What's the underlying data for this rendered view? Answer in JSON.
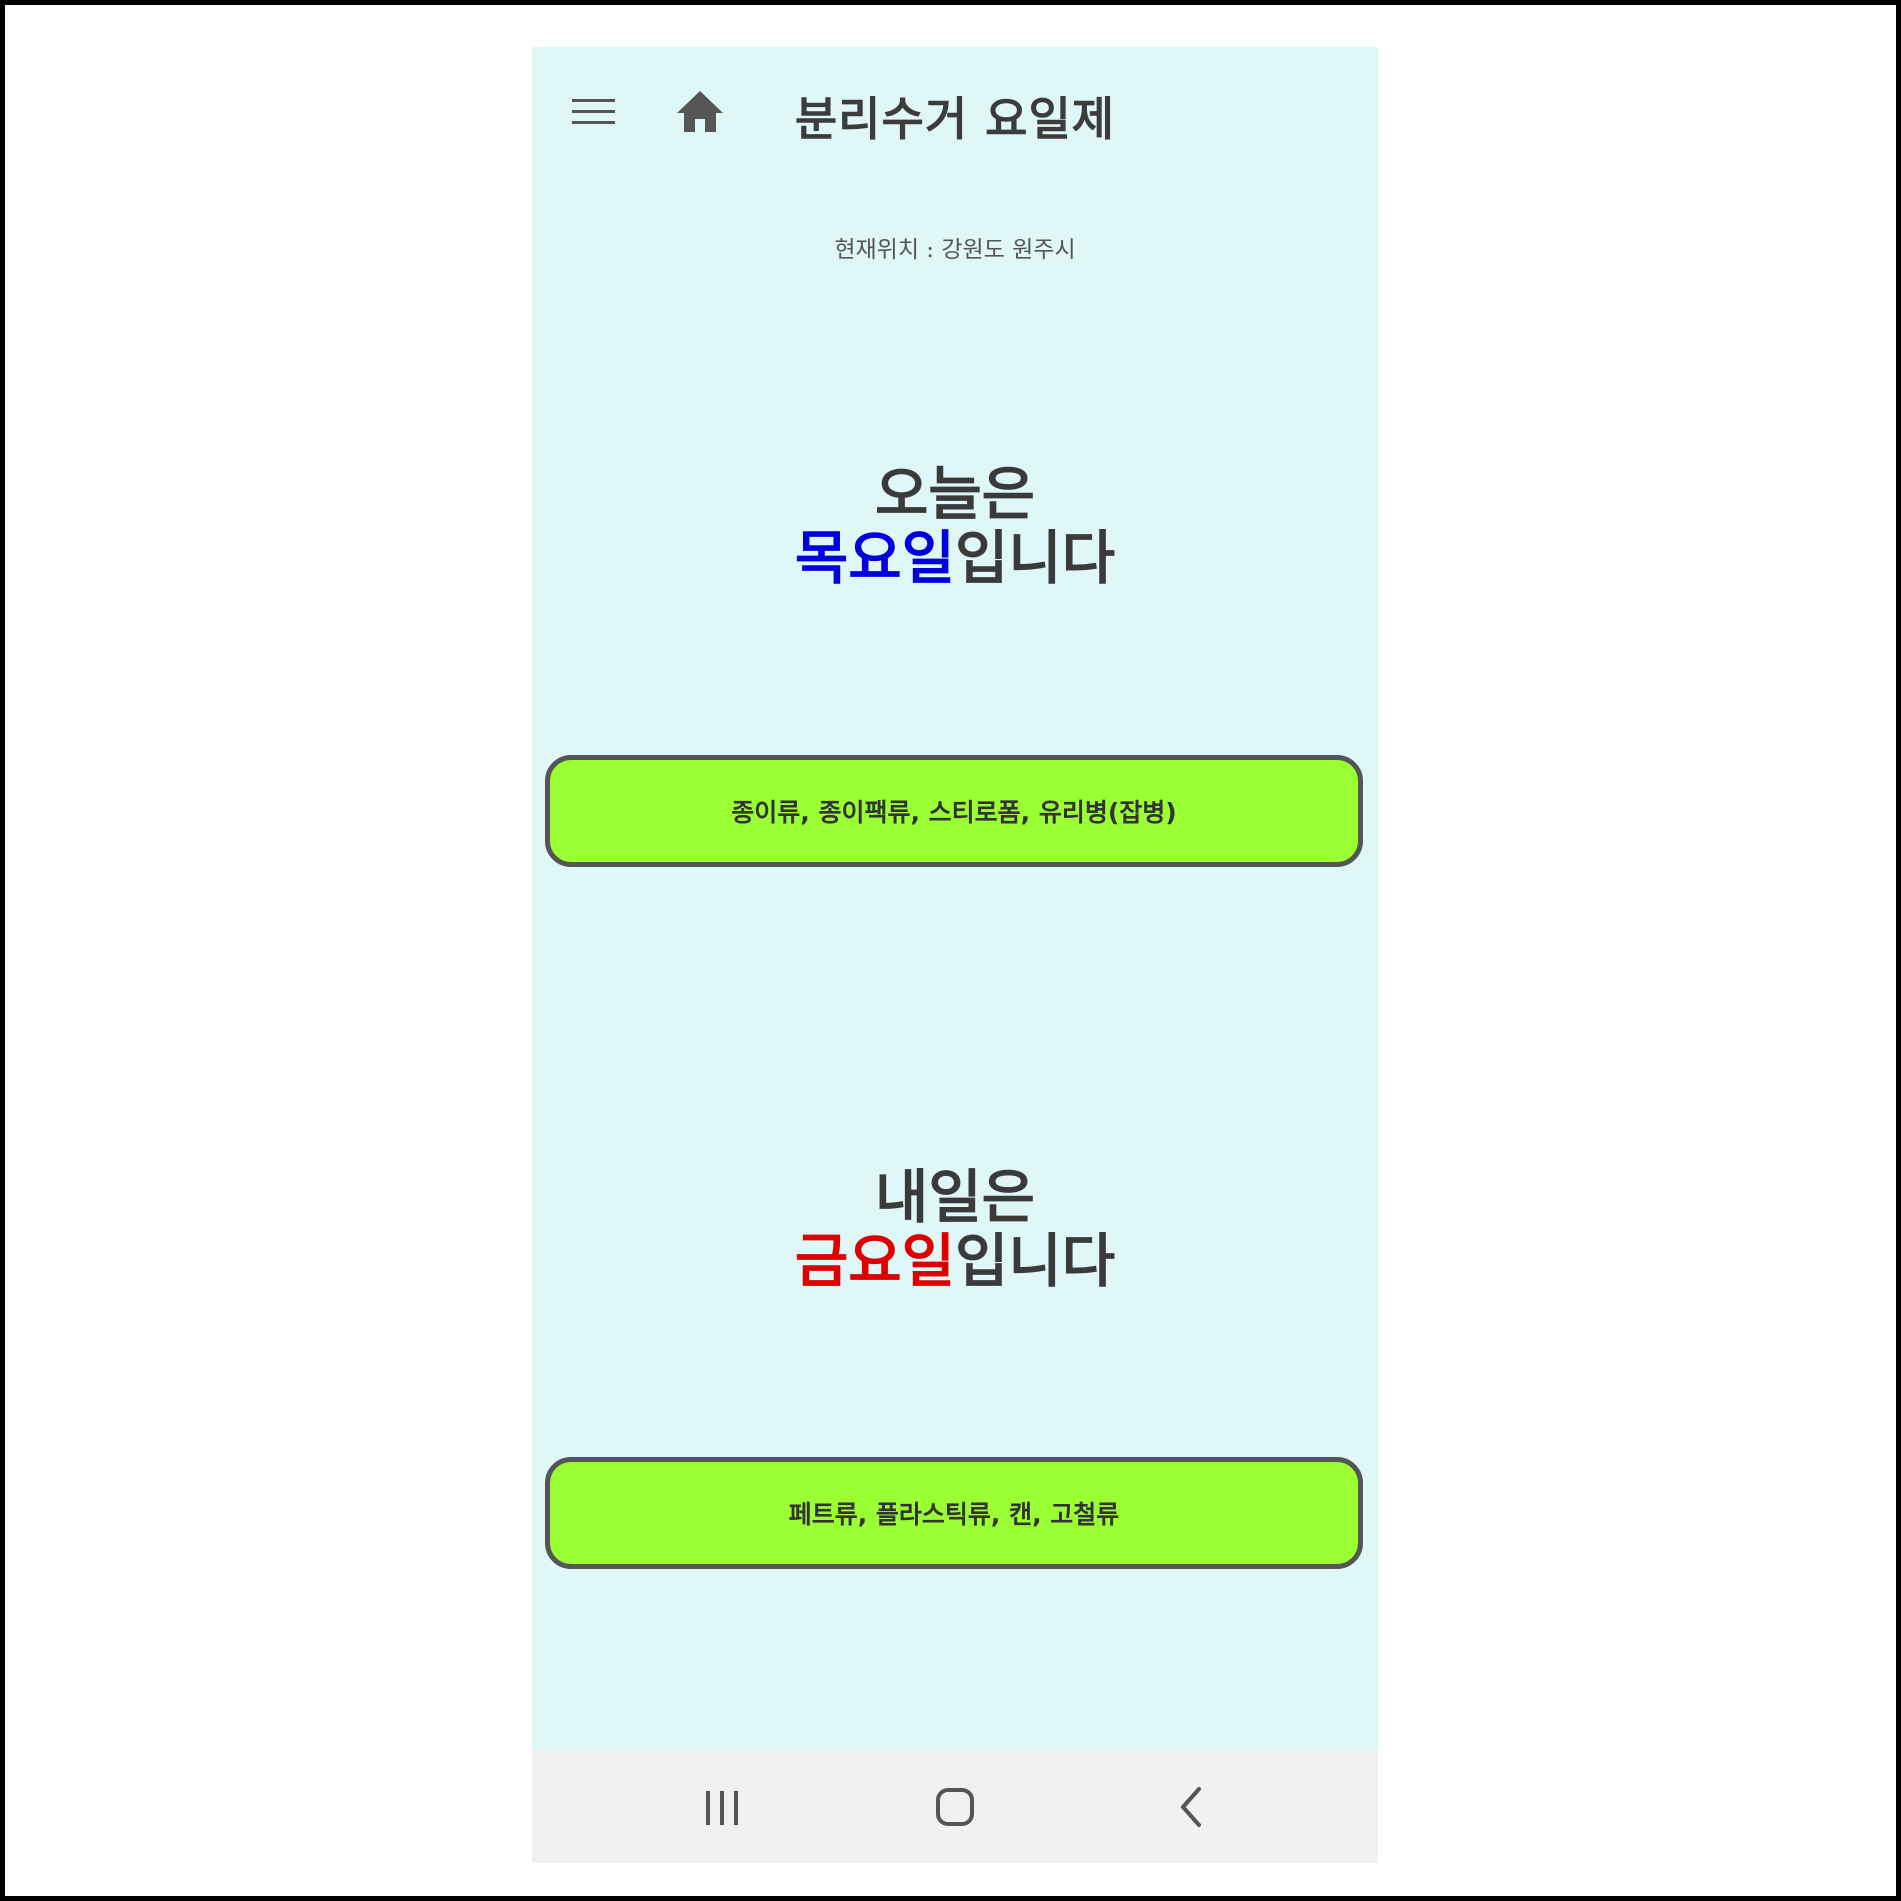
{
  "app": {
    "title": "분리수거 요일제"
  },
  "location": {
    "text": "현재위치 : 강원도 원주시"
  },
  "today": {
    "prefix": "오늘은",
    "day": "목요일",
    "suffix": "입니다",
    "day_color": "#0000dd",
    "items": "종이류, 종이팩류, 스티로폼, 유리병(잡병)"
  },
  "tomorrow": {
    "prefix": "내일은",
    "day": "금요일",
    "suffix": "입니다",
    "day_color": "#dd0000",
    "items": "페트류, 플라스틱류, 캔, 고철류"
  },
  "colors": {
    "background": "#e0f7f7",
    "pill": "#9aff33",
    "pill_border": "#555555",
    "navbar": "#f1f1f1"
  },
  "icons": {
    "menu": "menu-icon",
    "home": "home-icon",
    "recents": "recents-icon",
    "system_home": "system-home-icon",
    "back": "back-icon"
  }
}
